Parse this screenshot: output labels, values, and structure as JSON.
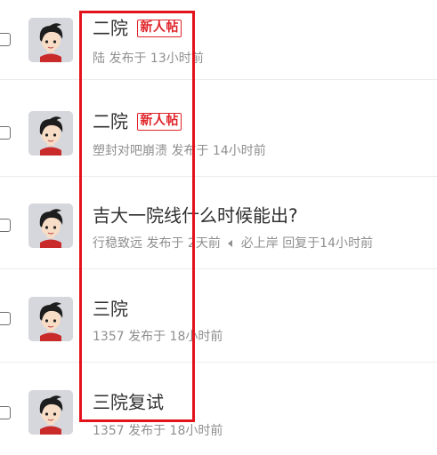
{
  "posts": [
    {
      "title": "二院",
      "tag": "新人帖",
      "author": "陆",
      "posted_label": "发布于",
      "posted_time": "13小时前"
    },
    {
      "title": "二院",
      "tag": "新人帖",
      "author": "塑封对吧崩溃",
      "posted_label": "发布于",
      "posted_time": "14小时前"
    },
    {
      "title": "吉大一院线什么时候能出?",
      "author": "行稳致远",
      "posted_label": "发布于",
      "posted_time": "2天前",
      "reply_icon": "reply-triangle-icon",
      "reply_author": "必上岸",
      "reply_text": "回复于14小时前"
    },
    {
      "title": "三院",
      "author": "1357",
      "posted_label": "发布于",
      "posted_time": "18小时前"
    },
    {
      "title": "三院复试",
      "author": "1357",
      "posted_label": "发布于",
      "posted_time": "18小时前"
    }
  ],
  "colors": {
    "highlight_box": "#e3131b",
    "new_tag": "#e0242a",
    "meta_text": "#8f8f8f",
    "title_text": "#2f2f2f"
  }
}
